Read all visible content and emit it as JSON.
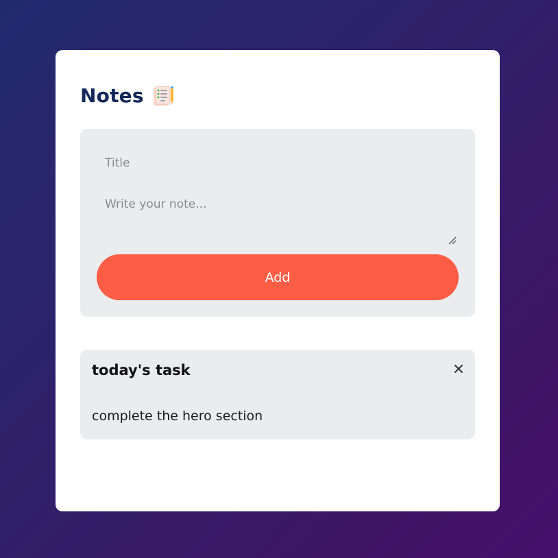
{
  "app": {
    "title": "Notes",
    "title_icon": "notepad-icon"
  },
  "form": {
    "title_placeholder": "Title",
    "title_value": "",
    "note_placeholder": "Write your note...",
    "note_value": "",
    "add_label": "Add"
  },
  "notes": [
    {
      "title": "today's task",
      "body": "complete the hero section",
      "delete_icon": "close-icon"
    }
  ],
  "colors": {
    "accent": "#fd5c45",
    "heading": "#14285a",
    "panel": "#ebecee",
    "background_start": "#222a6e",
    "background_end": "#45106a"
  }
}
